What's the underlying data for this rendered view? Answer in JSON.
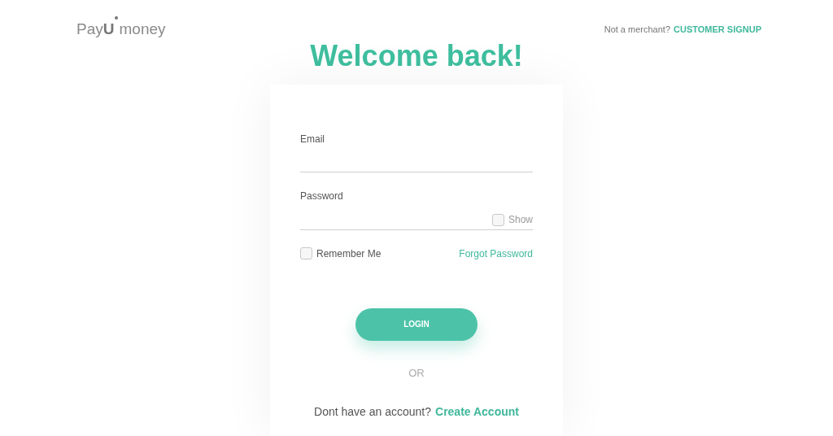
{
  "logo": {
    "lead": "Pay",
    "mark": "U",
    "tail": "money"
  },
  "header": {
    "prompt": "Not a merchant?",
    "link": "CUSTOMER SIGNUP"
  },
  "title": "Welcome back!",
  "form": {
    "email_label": "Email",
    "password_label": "Password",
    "show": {
      "label": "Show",
      "checked": false
    },
    "remember": {
      "label": "Remember Me",
      "checked": false
    },
    "forgot": "Forgot Password",
    "login": "LOGIN",
    "or": "OR",
    "signup_prompt": "Dont have an account?",
    "signup_link": "Create Account"
  }
}
